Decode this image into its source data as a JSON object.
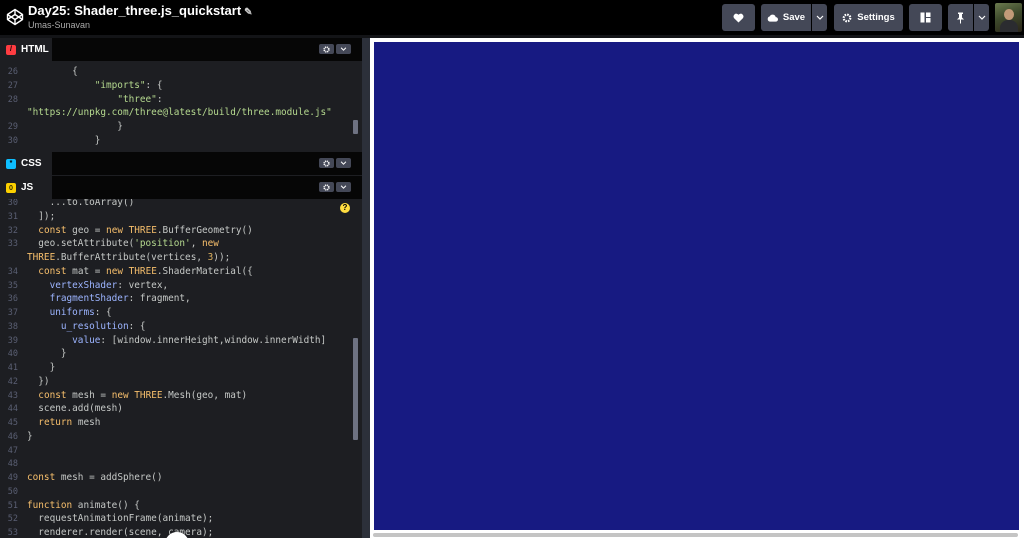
{
  "header": {
    "pen_title": "Day25: Shader_three.js_quickstart",
    "author": "Umas-Sunavan",
    "buttons": {
      "save_label": "Save",
      "settings_label": "Settings"
    }
  },
  "panels": {
    "html": {
      "label": "HTML",
      "icon_color": "#ff3c41",
      "icon_glyph": "/"
    },
    "css": {
      "label": "CSS",
      "icon_color": "#0ebeff",
      "icon_glyph": "*"
    },
    "js": {
      "label": "JS",
      "icon_color": "#fcd000",
      "icon_glyph": "()"
    }
  },
  "html_code": [
    {
      "n": "26",
      "html": "        {"
    },
    {
      "n": "27",
      "html": "            <span class=\"str\">\"imports\"</span>: {"
    },
    {
      "n": "28",
      "html": "                <span class=\"str\">\"three\"</span>:"
    },
    {
      "n": "",
      "html": "<span class=\"str\">\"https://unpkg.com/three@latest/build/three.module.js\"</span>"
    },
    {
      "n": "29",
      "html": "                }"
    },
    {
      "n": "30",
      "html": "            }"
    }
  ],
  "js_code": [
    {
      "n": "30",
      "html": "    ...to.toArray()"
    },
    {
      "n": "31",
      "html": "  ]);"
    },
    {
      "n": "32",
      "html": "  <span class=\"kw\">const</span> geo = <span class=\"kw\">new</span> <span class=\"cls\">THREE</span>.BufferGeometry()"
    },
    {
      "n": "33",
      "html": "  geo.setAttribute(<span class=\"str\">'position'</span>, <span class=\"kw\">new</span>"
    },
    {
      "n": "",
      "html": "<span class=\"cls\">THREE</span>.BufferAttribute(vertices, <span class=\"num\">3</span>));"
    },
    {
      "n": "34",
      "html": "  <span class=\"kw\">const</span> mat = <span class=\"kw\">new</span> <span class=\"cls\">THREE</span>.ShaderMaterial({"
    },
    {
      "n": "35",
      "html": "    <span class=\"prop\">vertexShader</span>: vertex,"
    },
    {
      "n": "36",
      "html": "    <span class=\"prop\">fragmentShader</span>: fragment,"
    },
    {
      "n": "37",
      "html": "    <span class=\"prop\">uniforms</span>: {"
    },
    {
      "n": "38",
      "html": "      <span class=\"prop\">u_resolution</span>: {"
    },
    {
      "n": "39",
      "html": "        <span class=\"prop\">value</span>: [window.innerHeight,window.innerWidth]"
    },
    {
      "n": "40",
      "html": "      }"
    },
    {
      "n": "41",
      "html": "    }"
    },
    {
      "n": "42",
      "html": "  })"
    },
    {
      "n": "43",
      "html": "  <span class=\"kw\">const</span> mesh = <span class=\"kw\">new</span> <span class=\"cls\">THREE</span>.Mesh(geo, mat)"
    },
    {
      "n": "44",
      "html": "  scene.add(mesh)"
    },
    {
      "n": "45",
      "html": "  <span class=\"kw\">return</span> mesh"
    },
    {
      "n": "46",
      "html": "}"
    },
    {
      "n": "47",
      "html": ""
    },
    {
      "n": "48",
      "html": ""
    },
    {
      "n": "49",
      "html": "<span class=\"kw\">const</span> mesh = addSphere()"
    },
    {
      "n": "50",
      "html": ""
    },
    {
      "n": "51",
      "html": "<span class=\"kw\">function</span> animate() {"
    },
    {
      "n": "52",
      "html": "  requestAnimationFrame(animate);"
    },
    {
      "n": "53",
      "html": "  renderer.render(scene, camera);"
    }
  ],
  "colors": {
    "canvas": "#171a82",
    "header_bg": "#000000",
    "editor_bg": "#1d1e22",
    "button_bg": "#444857"
  }
}
